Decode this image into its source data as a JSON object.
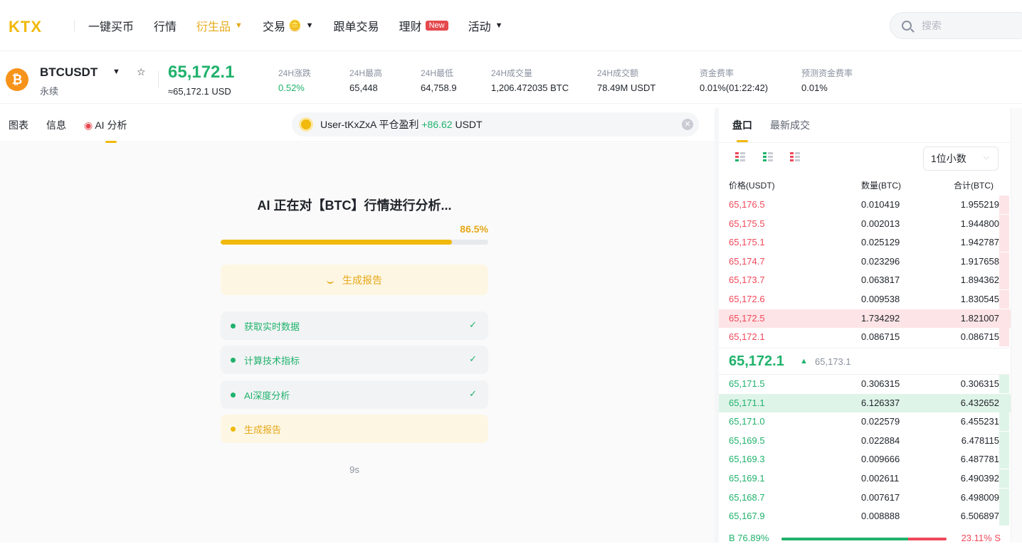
{
  "brand": {
    "logo": "KTX",
    "accent": "#f0b90b",
    "up_color": "#20b26c",
    "down_color": "#f0485a"
  },
  "nav": {
    "items": [
      {
        "label": "一键买币",
        "active": false
      },
      {
        "label": "行情",
        "active": false
      },
      {
        "label": "衍生品",
        "active": true,
        "caret": "▼"
      },
      {
        "label": "交易",
        "active": false,
        "caret": "▼",
        "icon": "coin-stack-icon"
      },
      {
        "label": "跟单交易",
        "active": false
      },
      {
        "label": "理财",
        "active": false,
        "badge": "New"
      },
      {
        "label": "活动",
        "active": false,
        "caret": "▼"
      }
    ],
    "search_placeholder": "搜索"
  },
  "ticker": {
    "symbol": "BTCUSDT",
    "type": "永续",
    "price": "65,172.1",
    "usd_price": "≈65,172.1 USD",
    "stats": [
      {
        "label": "24H涨跌",
        "value": "0.52%",
        "color": "green"
      },
      {
        "label": "24H最高",
        "value": "65,448"
      },
      {
        "label": "24H最低",
        "value": "64,758.9"
      },
      {
        "label": "24H成交量",
        "value": "1,206.472035 BTC"
      },
      {
        "label": "24H成交额",
        "value": "78.49M USDT"
      },
      {
        "label": "资金费率",
        "value": "0.01%(01:22:42)"
      },
      {
        "label": "预测资金费率",
        "value": "0.01%"
      }
    ]
  },
  "left_tabs": {
    "chart": "图表",
    "info": "信息",
    "ai": "AI 分析"
  },
  "notification": {
    "user": "User-tKxZxA",
    "action": "平仓盈利",
    "amount": "+86.62",
    "unit": "USDT"
  },
  "ai_panel": {
    "title": "AI 正在对【BTC】行情进行分析...",
    "progress_label": "86.5%",
    "progress": 0.865,
    "button_label": "生成报告",
    "steps": [
      {
        "label": "获取实时数据",
        "done": true
      },
      {
        "label": "计算技术指标",
        "done": true
      },
      {
        "label": "AI深度分析",
        "done": true
      },
      {
        "label": "生成报告",
        "done": false
      }
    ],
    "check_mark": "✓",
    "timer": "9s"
  },
  "orderbook": {
    "tabs": {
      "book": "盘口",
      "trades": "最新成交"
    },
    "decimals": "1位小数",
    "headers": {
      "price": "价格(USDT)",
      "qty": "数量(BTC)",
      "total": "合计(BTC)"
    },
    "asks": [
      {
        "price": "65,176.5",
        "qty": "0.010419",
        "total": "1.955219",
        "depth": 1.0
      },
      {
        "price": "65,175.5",
        "qty": "0.002013",
        "total": "1.944800",
        "depth": 1.0
      },
      {
        "price": "65,175.1",
        "qty": "0.025129",
        "total": "1.942787",
        "depth": 1.0
      },
      {
        "price": "65,174.7",
        "qty": "0.023296",
        "total": "1.917658",
        "depth": 1.0
      },
      {
        "price": "65,173.7",
        "qty": "0.063817",
        "total": "1.894362",
        "depth": 1.0
      },
      {
        "price": "65,172.6",
        "qty": "0.009538",
        "total": "1.830545",
        "depth": 1.0
      },
      {
        "price": "65,172.5",
        "qty": "1.734292",
        "total": "1.821007",
        "depth": 1.0,
        "highlight": true
      },
      {
        "price": "65,172.1",
        "qty": "0.086715",
        "total": "0.086715",
        "depth": 1.0
      }
    ],
    "last_price": "65,172.1",
    "last_arrow": "▲",
    "mark_price": "65,173.1",
    "bids": [
      {
        "price": "65,171.5",
        "qty": "0.306315",
        "total": "0.306315",
        "depth": 1.0
      },
      {
        "price": "65,171.1",
        "qty": "6.126337",
        "total": "6.432652",
        "depth": 1.0,
        "highlight": true
      },
      {
        "price": "65,171.0",
        "qty": "0.022579",
        "total": "6.455231",
        "depth": 1.0
      },
      {
        "price": "65,169.5",
        "qty": "0.022884",
        "total": "6.478115",
        "depth": 1.0
      },
      {
        "price": "65,169.3",
        "qty": "0.009666",
        "total": "6.487781",
        "depth": 1.0
      },
      {
        "price": "65,169.1",
        "qty": "0.002611",
        "total": "6.490392",
        "depth": 1.0
      },
      {
        "price": "65,168.7",
        "qty": "0.007617",
        "total": "6.498009",
        "depth": 1.0
      },
      {
        "price": "65,167.9",
        "qty": "0.008888",
        "total": "6.506897",
        "depth": 1.0
      }
    ],
    "buy_ratio_label": "B 76.89%",
    "sell_ratio_label": "23.11% S",
    "buy_ratio": 0.7689
  }
}
